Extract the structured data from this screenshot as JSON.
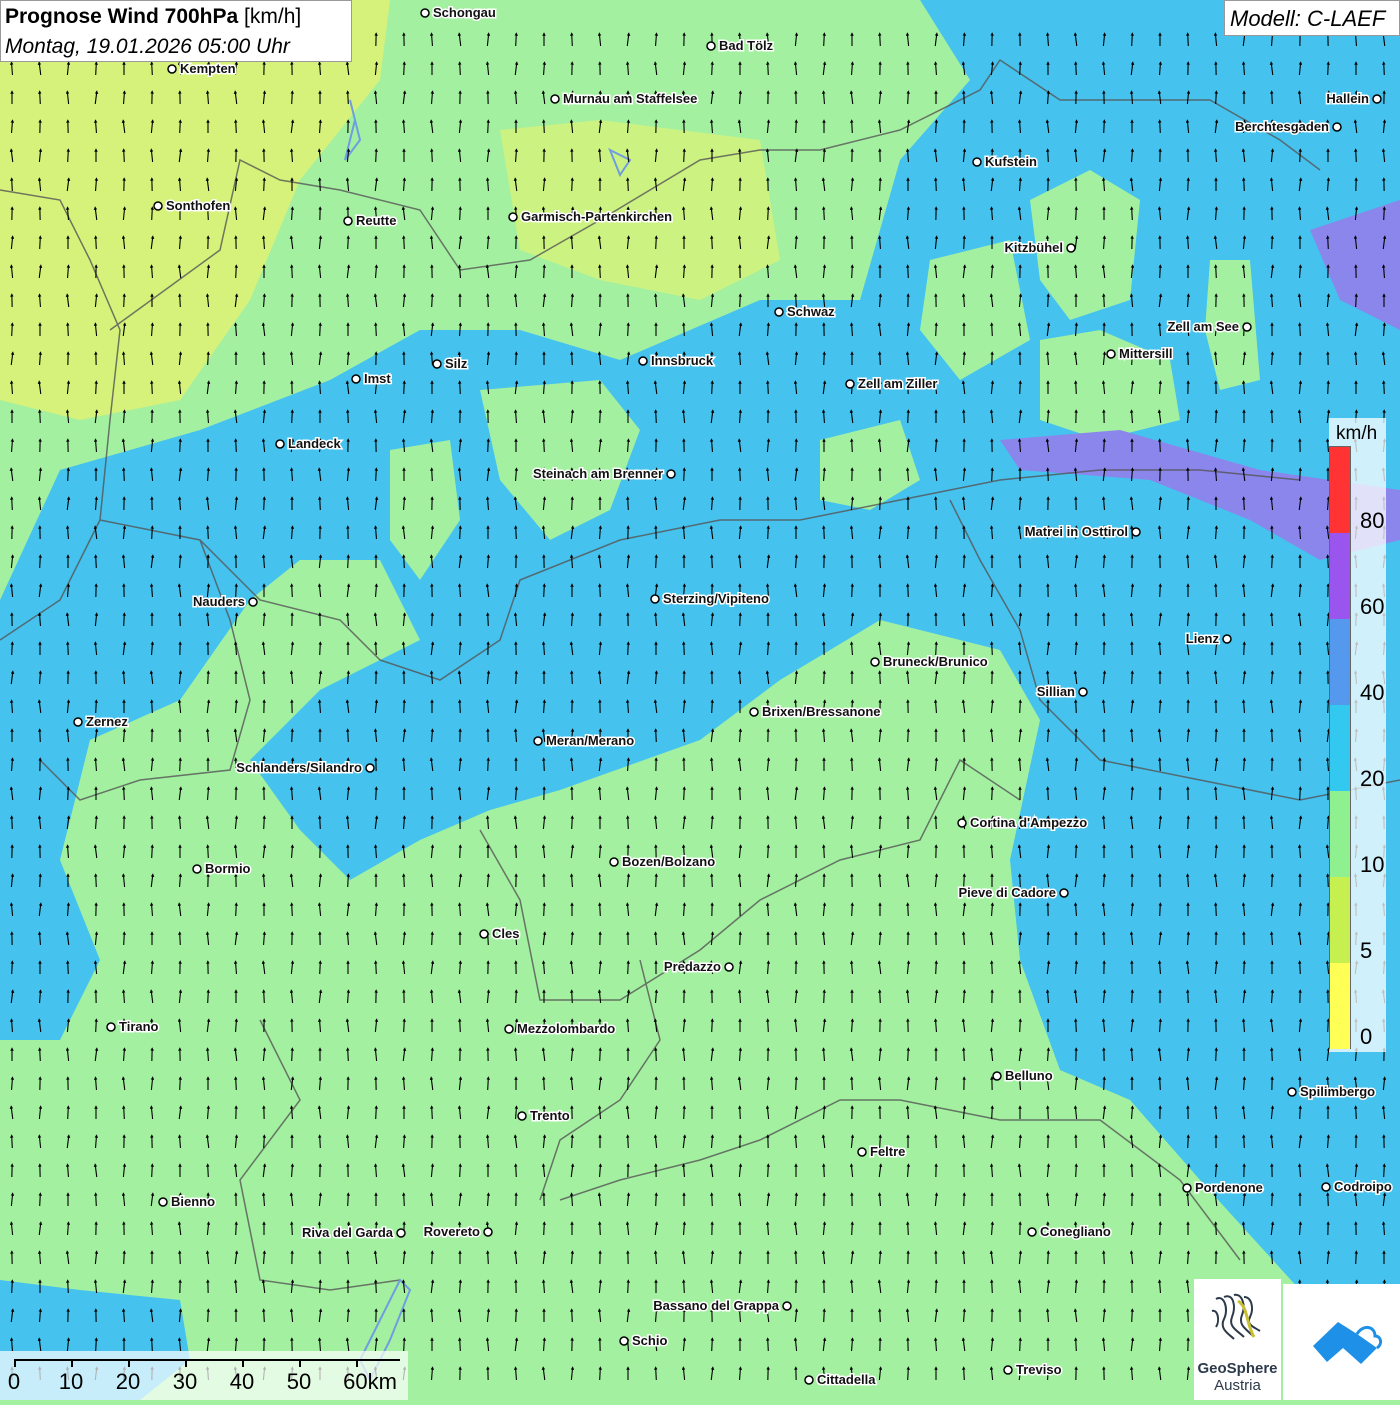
{
  "header": {
    "title_bold": "Prognose Wind 700hPa",
    "title_unit": "[km/h]",
    "datetime": "Montag, 19.01.2026 05:00 Uhr"
  },
  "model": {
    "label": "Modell: C-LAEF"
  },
  "legend": {
    "unit": "km/h",
    "ticks": [
      {
        "value": "80",
        "color": "#ff3333"
      },
      {
        "value": "60",
        "color": "#9955ee"
      },
      {
        "value": "40",
        "color": "#5599ee"
      },
      {
        "value": "20",
        "color": "#33c8f0"
      },
      {
        "value": "10",
        "color": "#8ff08f"
      },
      {
        "value": "5",
        "color": "#c6f050"
      },
      {
        "value": "0",
        "color": "#ffff55"
      }
    ]
  },
  "scale_bar": {
    "labels": [
      "0",
      "10",
      "20",
      "30",
      "40",
      "50",
      "60km"
    ]
  },
  "logos": {
    "geosphere_line1": "GeoSphere",
    "geosphere_line2": "Austria"
  },
  "cities": [
    {
      "name": "Schongau"
    },
    {
      "name": "Bad Tölz"
    },
    {
      "name": "Kempten"
    },
    {
      "name": "Murnau am Staffelsee"
    },
    {
      "name": "Hallein"
    },
    {
      "name": "Berchtesgaden"
    },
    {
      "name": "Kufstein"
    },
    {
      "name": "Sonthofen"
    },
    {
      "name": "Reutte"
    },
    {
      "name": "Garmisch-Partenkirchen"
    },
    {
      "name": "Kitzbühel"
    },
    {
      "name": "Schwaz"
    },
    {
      "name": "Zell am See"
    },
    {
      "name": "Mittersill"
    },
    {
      "name": "Silz"
    },
    {
      "name": "Imst"
    },
    {
      "name": "Innsbruck"
    },
    {
      "name": "Zell am Ziller"
    },
    {
      "name": "Landeck"
    },
    {
      "name": "Steinach am Brenner"
    },
    {
      "name": "Matrei in Osttirol"
    },
    {
      "name": "Nauders"
    },
    {
      "name": "Sterzing/Vipiteno"
    },
    {
      "name": "Lienz"
    },
    {
      "name": "Bruneck/Brunico"
    },
    {
      "name": "Sillian"
    },
    {
      "name": "Brixen/Bressanone"
    },
    {
      "name": "Zernez"
    },
    {
      "name": "Meran/Merano"
    },
    {
      "name": "Schlanders/Silandro"
    },
    {
      "name": "Cortina d'Ampezzo"
    },
    {
      "name": "Bozen/Bolzano"
    },
    {
      "name": "Bormio"
    },
    {
      "name": "Pieve di Cadore"
    },
    {
      "name": "Cles"
    },
    {
      "name": "Predazzo"
    },
    {
      "name": "Tirano"
    },
    {
      "name": "Mezzolombardo"
    },
    {
      "name": "Belluno"
    },
    {
      "name": "Spilimbergo"
    },
    {
      "name": "Trento"
    },
    {
      "name": "Feltre"
    },
    {
      "name": "Pordenone"
    },
    {
      "name": "Codroipo"
    },
    {
      "name": "Bienno"
    },
    {
      "name": "Riva del Garda"
    },
    {
      "name": "Rovereto"
    },
    {
      "name": "Conegliano"
    },
    {
      "name": "Bassano del Grappa"
    },
    {
      "name": "Schio"
    },
    {
      "name": "Treviso"
    },
    {
      "name": "Cittadella"
    }
  ]
}
